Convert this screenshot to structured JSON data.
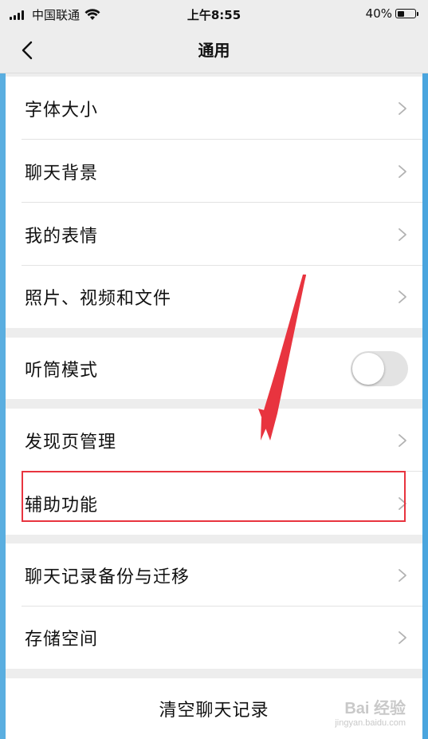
{
  "status_bar": {
    "carrier": "中国联通",
    "time": "上午8:55",
    "battery_percent": "40%",
    "battery_level": 0.4,
    "icons": [
      "signal-icon",
      "wifi-icon",
      "battery-icon"
    ]
  },
  "nav": {
    "title": "通用",
    "back_icon": "chevron-left-icon"
  },
  "groups": {
    "g1": [
      "字体大小",
      "聊天背景",
      "我的表情",
      "照片、视频和文件"
    ],
    "g2": {
      "label": "听筒模式",
      "toggle_on": false
    },
    "g3": [
      "发现页管理",
      "辅助功能"
    ],
    "g4": [
      "聊天记录备份与迁移",
      "存储空间"
    ],
    "g5": {
      "label": "清空聊天记录"
    }
  },
  "annotation": {
    "highlight_color": "#e8343f",
    "highlighted_item": "辅助功能"
  },
  "watermark": {
    "main": "Bai 经验",
    "sub": "jingyan.baidu.com"
  },
  "colors": {
    "background": "#ededed",
    "card": "#ffffff",
    "accent_red": "#e8343f"
  }
}
